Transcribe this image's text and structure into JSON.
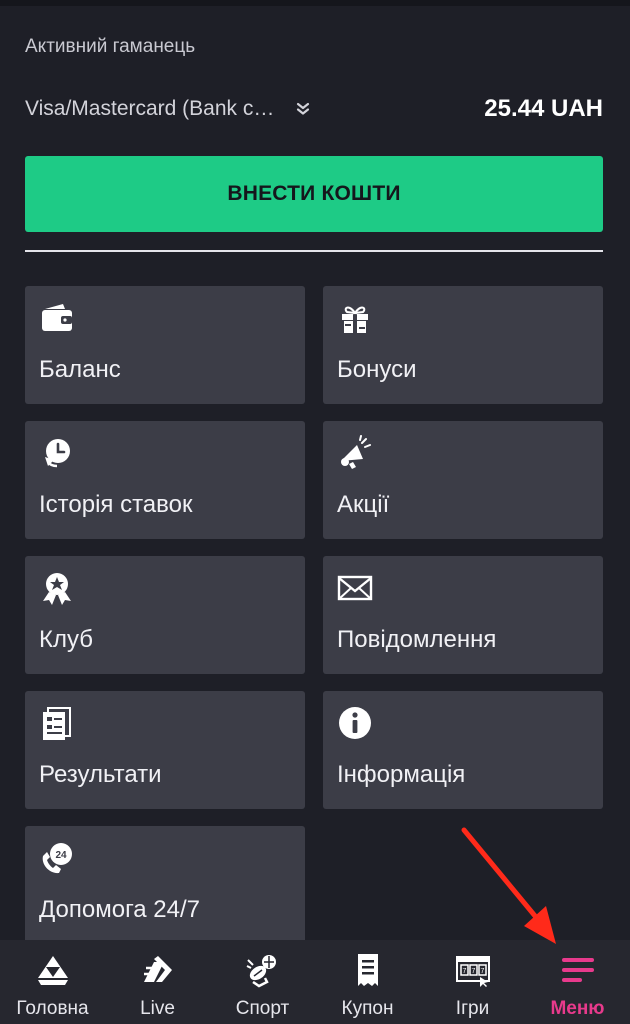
{
  "wallet": {
    "label": "Активний гаманець",
    "method": "Visa/Mastercard (Bank c…",
    "amount": "25.44 UAH"
  },
  "deposit": {
    "label": "ВНЕСТИ КОШТИ"
  },
  "tiles": [
    {
      "label": "Баланс",
      "icon": "wallet-icon"
    },
    {
      "label": "Бонуси",
      "icon": "gift-icon"
    },
    {
      "label": "Історія ставок",
      "icon": "history-icon"
    },
    {
      "label": "Акції",
      "icon": "megaphone-icon"
    },
    {
      "label": "Клуб",
      "icon": "medal-icon"
    },
    {
      "label": "Повідомлення",
      "icon": "envelope-icon"
    },
    {
      "label": "Результати",
      "icon": "results-icon"
    },
    {
      "label": "Інформація",
      "icon": "info-icon"
    },
    {
      "label": "Допомога 24/7",
      "icon": "support-24-icon"
    }
  ],
  "nav": [
    {
      "label": "Головна",
      "icon": "home-logo-icon"
    },
    {
      "label": "Live",
      "icon": "live-icon"
    },
    {
      "label": "Спорт",
      "icon": "sport-icon"
    },
    {
      "label": "Купон",
      "icon": "coupon-icon"
    },
    {
      "label": "Ігри",
      "icon": "slots-icon"
    },
    {
      "label": "Меню",
      "icon": "menu-icon",
      "active": true
    }
  ],
  "colors": {
    "background": "#1e1f27",
    "tile": "#3c3d47",
    "deposit": "#1ecb86",
    "active": "#e83a8c",
    "annotation_arrow": "#ff2a1a"
  }
}
